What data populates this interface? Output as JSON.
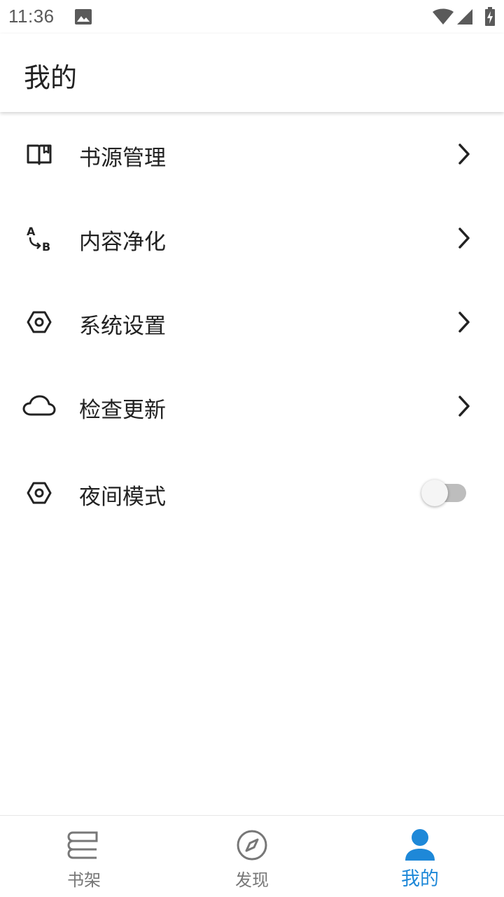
{
  "status_bar": {
    "time": "11:36"
  },
  "app_bar": {
    "title": "我的"
  },
  "menu": [
    {
      "label": "书源管理",
      "icon": "book-icon",
      "trailing": "chevron"
    },
    {
      "label": "内容净化",
      "icon": "replace-icon",
      "trailing": "chevron"
    },
    {
      "label": "系统设置",
      "icon": "settings-icon",
      "trailing": "chevron"
    },
    {
      "label": "检查更新",
      "icon": "cloud-icon",
      "trailing": "chevron"
    },
    {
      "label": "夜间模式",
      "icon": "settings-icon",
      "trailing": "toggle",
      "toggle_on": false
    }
  ],
  "bottom_nav": [
    {
      "label": "书架",
      "icon": "bookshelf-icon",
      "active": false
    },
    {
      "label": "发现",
      "icon": "compass-icon",
      "active": false
    },
    {
      "label": "我的",
      "icon": "person-icon",
      "active": true
    }
  ],
  "colors": {
    "accent": "#1e88d8",
    "text": "#222222",
    "inactive": "#777777"
  }
}
